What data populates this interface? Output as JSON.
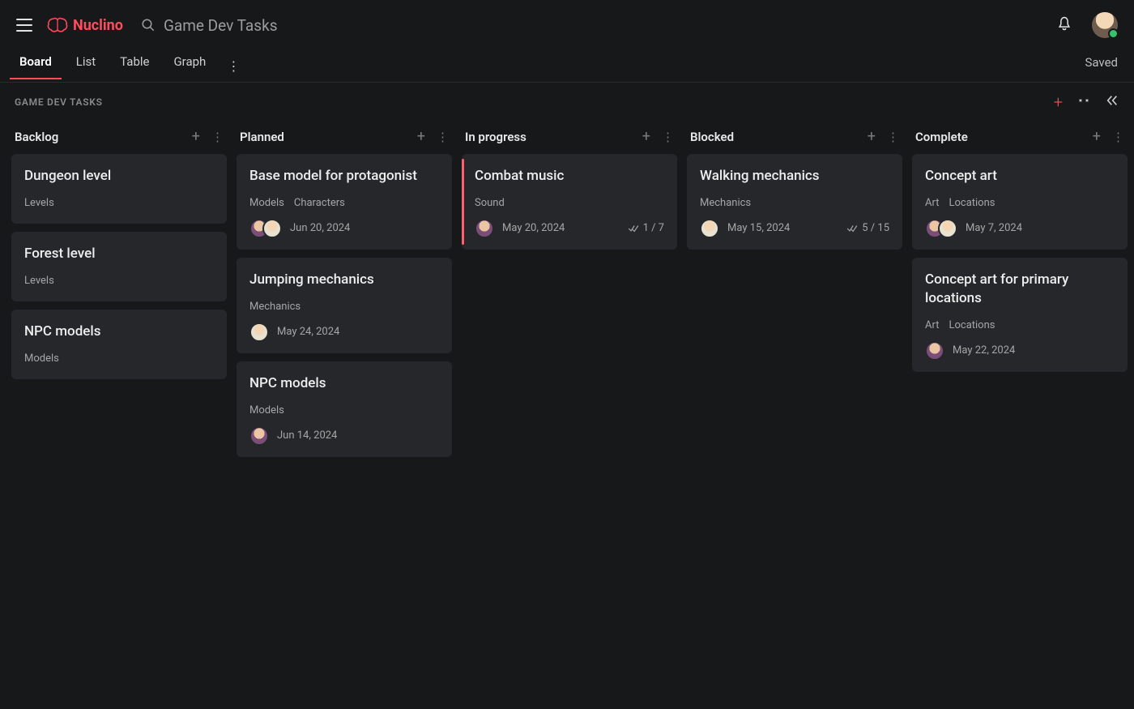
{
  "app": {
    "name": "Nuclino",
    "workspace_title": "Game Dev Tasks",
    "saved_label": "Saved",
    "breadcrumb": "GAME DEV TASKS"
  },
  "tabs": [
    {
      "label": "Board",
      "active": true
    },
    {
      "label": "List",
      "active": false
    },
    {
      "label": "Table",
      "active": false
    },
    {
      "label": "Graph",
      "active": false
    }
  ],
  "columns": [
    {
      "title": "Backlog",
      "cards": [
        {
          "title": "Dungeon level",
          "labels": [
            "Levels"
          ],
          "avatars": [],
          "date": "",
          "checklist": "",
          "accent": false
        },
        {
          "title": "Forest level",
          "labels": [
            "Levels"
          ],
          "avatars": [],
          "date": "",
          "checklist": "",
          "accent": false
        },
        {
          "title": "NPC models",
          "labels": [
            "Models"
          ],
          "avatars": [],
          "date": "",
          "checklist": "",
          "accent": false
        }
      ]
    },
    {
      "title": "Planned",
      "cards": [
        {
          "title": "Base model for protagonist",
          "labels": [
            "Models",
            "Characters"
          ],
          "avatars": [
            "a1",
            "a2"
          ],
          "date": "Jun 20, 2024",
          "checklist": "",
          "accent": false
        },
        {
          "title": "Jumping mechanics",
          "labels": [
            "Mechanics"
          ],
          "avatars": [
            "a2"
          ],
          "date": "May 24, 2024",
          "checklist": "",
          "accent": false
        },
        {
          "title": "NPC models",
          "labels": [
            "Models"
          ],
          "avatars": [
            "a1"
          ],
          "date": "Jun 14, 2024",
          "checklist": "",
          "accent": false
        }
      ]
    },
    {
      "title": "In progress",
      "cards": [
        {
          "title": "Combat music",
          "labels": [
            "Sound"
          ],
          "avatars": [
            "a1"
          ],
          "date": "May 20, 2024",
          "checklist": "1 / 7",
          "accent": true
        }
      ]
    },
    {
      "title": "Blocked",
      "cards": [
        {
          "title": "Walking mechanics",
          "labels": [
            "Mechanics"
          ],
          "avatars": [
            "a2"
          ],
          "date": "May 15, 2024",
          "checklist": "5 / 15",
          "accent": false
        }
      ]
    },
    {
      "title": "Complete",
      "cards": [
        {
          "title": "Concept art",
          "labels": [
            "Art",
            "Locations"
          ],
          "avatars": [
            "a1",
            "a2"
          ],
          "date": "May 7, 2024",
          "checklist": "",
          "accent": false
        },
        {
          "title": "Concept art for primary locations",
          "labels": [
            "Art",
            "Locations"
          ],
          "avatars": [
            "a1"
          ],
          "date": "May 22, 2024",
          "checklist": "",
          "accent": false
        }
      ]
    }
  ]
}
